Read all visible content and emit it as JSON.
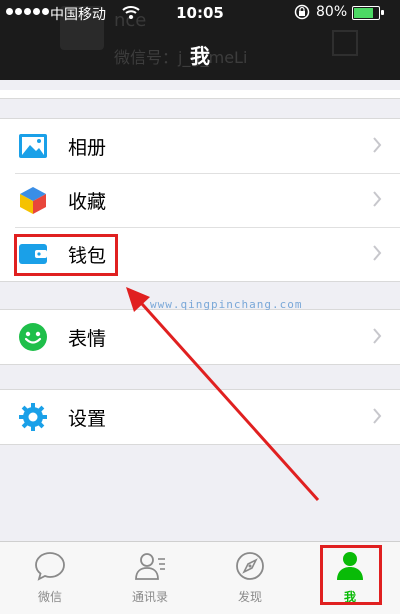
{
  "status_bar": {
    "carrier": "中国移动",
    "time": "10:05",
    "battery_percent": "80%",
    "battery_level": 0.8
  },
  "header": {
    "title": "我",
    "background_profile": {
      "name": "nce",
      "wechat_id": "微信号：j_g_meLi"
    }
  },
  "menu": {
    "groups": [
      {
        "items": [
          {
            "label": "相册",
            "icon": "photo-album-icon"
          },
          {
            "label": "收藏",
            "icon": "favorites-cube-icon"
          },
          {
            "label": "钱包",
            "icon": "wallet-icon",
            "highlighted": true
          }
        ]
      },
      {
        "items": [
          {
            "label": "表情",
            "icon": "emoji-smiley-icon"
          }
        ]
      },
      {
        "items": [
          {
            "label": "设置",
            "icon": "settings-gear-icon"
          }
        ]
      }
    ]
  },
  "annotation": {
    "watermark": "www.qingpinchang.com",
    "color": "#e02020"
  },
  "tabbar": {
    "tabs": [
      {
        "label": "微信",
        "icon": "chat-bubble-icon",
        "active": false
      },
      {
        "label": "通讯录",
        "icon": "contacts-icon",
        "active": false
      },
      {
        "label": "发现",
        "icon": "compass-icon",
        "active": false
      },
      {
        "label": "我",
        "icon": "person-icon",
        "active": true
      }
    ]
  },
  "colors": {
    "accent_green": "#09bb07",
    "header_bg": "#1b1b1b",
    "page_bg": "#efeff4"
  }
}
